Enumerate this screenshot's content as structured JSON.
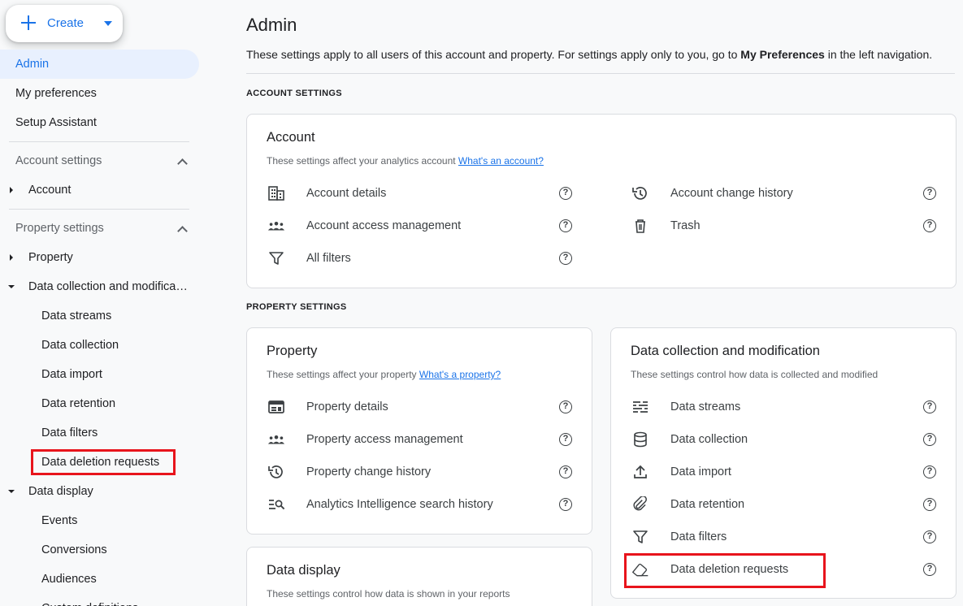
{
  "sidebar": {
    "create_label": "Create",
    "admin": "Admin",
    "my_preferences": "My preferences",
    "setup_assistant": "Setup Assistant",
    "account_settings_heading": "Account settings",
    "account": "Account",
    "property_settings_heading": "Property settings",
    "property": "Property",
    "data_collection_mod": "Data collection and modifica…",
    "sub_items": [
      "Data streams",
      "Data collection",
      "Data import",
      "Data retention",
      "Data filters",
      "Data deletion requests"
    ],
    "data_display": "Data display",
    "display_items": [
      "Events",
      "Conversions",
      "Audiences",
      "Custom definitions"
    ]
  },
  "main": {
    "title": "Admin",
    "desc_prefix": "These settings apply to all users of this account and property. For settings apply only to you, go to ",
    "desc_bold": "My Preferences",
    "desc_suffix": " in the left navigation.",
    "account_settings_label": "ACCOUNT SETTINGS",
    "property_settings_label": "PROPERTY SETTINGS",
    "help_glyph": "?",
    "account_card": {
      "title": "Account",
      "subtitle": "These settings affect your analytics account ",
      "link": "What's an account?",
      "items_left": [
        "Account details",
        "Account access management",
        "All filters"
      ],
      "items_right": [
        "Account change history",
        "Trash"
      ]
    },
    "property_card": {
      "title": "Property",
      "subtitle": "These settings affect your property ",
      "link": "What's a property?",
      "items": [
        "Property details",
        "Property access management",
        "Property change history",
        "Analytics Intelligence search history"
      ]
    },
    "data_collection_card": {
      "title": "Data collection and modification",
      "subtitle": "These settings control how data is collected and modified",
      "items": [
        "Data streams",
        "Data collection",
        "Data import",
        "Data retention",
        "Data filters",
        "Data deletion requests"
      ]
    },
    "data_display_card": {
      "title": "Data display",
      "subtitle": "These settings control how data is shown in your reports"
    }
  },
  "colors": {
    "accent": "#1a73e8",
    "highlight": "#e8141c",
    "active_bg": "#e8f0fe"
  }
}
